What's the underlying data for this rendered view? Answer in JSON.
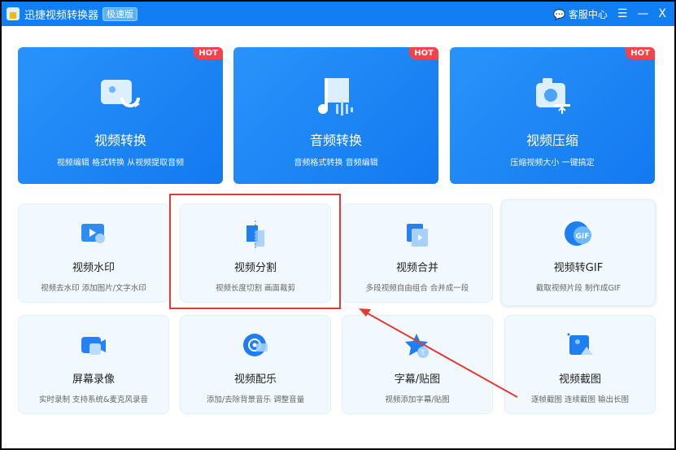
{
  "titlebar": {
    "title": "迅捷视频转换器",
    "edition": "极速版",
    "support": "客服中心",
    "menu": "☰",
    "minimize": "—",
    "close": "X"
  },
  "hot_label": "HOT",
  "top_tools": [
    {
      "title": "视频转换",
      "desc": "视频编辑 格式转换 从视频提取音频"
    },
    {
      "title": "音频转换",
      "desc": "音频格式转换 音频编辑"
    },
    {
      "title": "视频压缩",
      "desc": "压缩视频大小 一键搞定"
    }
  ],
  "tools": [
    {
      "title": "视频水印",
      "desc": "视频去水印 添加图片/文字水印"
    },
    {
      "title": "视频分割",
      "desc": "视频长度切割 画面裁剪"
    },
    {
      "title": "视频合并",
      "desc": "多段视频自由组合 合并成一段"
    },
    {
      "title": "视频转GIF",
      "desc": "截取视频片段 制作成GIF"
    },
    {
      "title": "屏幕录像",
      "desc": "实时录制 支持系统&麦克风录音"
    },
    {
      "title": "视频配乐",
      "desc": "添加/去除背景音乐 调整音量"
    },
    {
      "title": "字幕/贴图",
      "desc": "视频添加字幕/贴图"
    },
    {
      "title": "视频截图",
      "desc": "逐帧截图 连续截图 输出长图"
    }
  ],
  "gif_icon_text": "GIF",
  "colors": {
    "brand": "#127ef4",
    "hot": "#f2434b",
    "annotation": "#e53935"
  }
}
